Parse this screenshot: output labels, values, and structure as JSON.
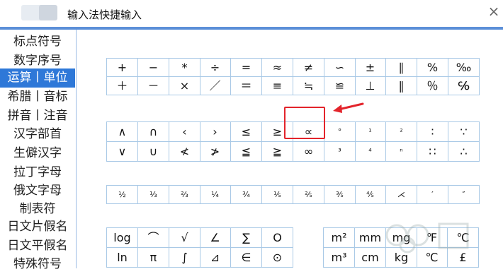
{
  "title_bar": {
    "title": "输入法快捷输入",
    "close_label": "×"
  },
  "sidebar": {
    "selected_index": 2,
    "items": [
      {
        "label": "标点符号"
      },
      {
        "label": "数字序号"
      },
      {
        "label": "运算丨单位"
      },
      {
        "label": "希腊丨音标"
      },
      {
        "label": "拼音丨注音"
      },
      {
        "label": "汉字部首"
      },
      {
        "label": "生僻汉字"
      },
      {
        "label": "拉丁字母"
      },
      {
        "label": "俄文字母"
      },
      {
        "label": "制表符"
      },
      {
        "label": "日文片假名"
      },
      {
        "label": "日文平假名"
      },
      {
        "label": "特殊符号"
      }
    ]
  },
  "symbol_groups": [
    {
      "rows": [
        [
          "+",
          "−",
          "*",
          "÷",
          "=",
          "≈",
          "≠",
          "∽",
          "±",
          "∥",
          "%",
          "‰"
        ],
        [
          "＋",
          "－",
          "×",
          "／",
          "＝",
          "≡",
          "≒",
          "≌",
          "⊥",
          "‖",
          "％",
          "℅"
        ]
      ]
    },
    {
      "rows": [
        [
          "∧",
          "∩",
          "‹",
          "›",
          "≤",
          "≥",
          "∝",
          "°",
          "¹",
          "²",
          "∶",
          "∵"
        ],
        [
          "∨",
          "∪",
          "≮",
          "≯",
          "≦",
          "≧",
          "∞",
          "³",
          "⁴",
          "ⁿ",
          "∷",
          "∴"
        ]
      ]
    },
    {
      "rows": [
        [
          "½",
          "⅓",
          "⅔",
          "¼",
          "¾",
          "⅕",
          "⅖",
          "⅗",
          "⅘",
          "⋌",
          "′",
          "″"
        ]
      ]
    },
    {
      "rows": [
        [
          "log",
          "⌒",
          "√",
          "∠",
          "∑",
          "Ο"
        ],
        [
          "ln",
          "π",
          "∫",
          "⊿",
          "∈",
          "⊙"
        ]
      ]
    },
    {
      "rows": [
        [
          "m²",
          "mm",
          "mg",
          "℉",
          "℃"
        ],
        [
          "m³",
          "cm",
          "kg",
          "℃",
          "£"
        ]
      ]
    }
  ],
  "highlight_color": "#e3242b",
  "accent_color": "#2e78d8"
}
